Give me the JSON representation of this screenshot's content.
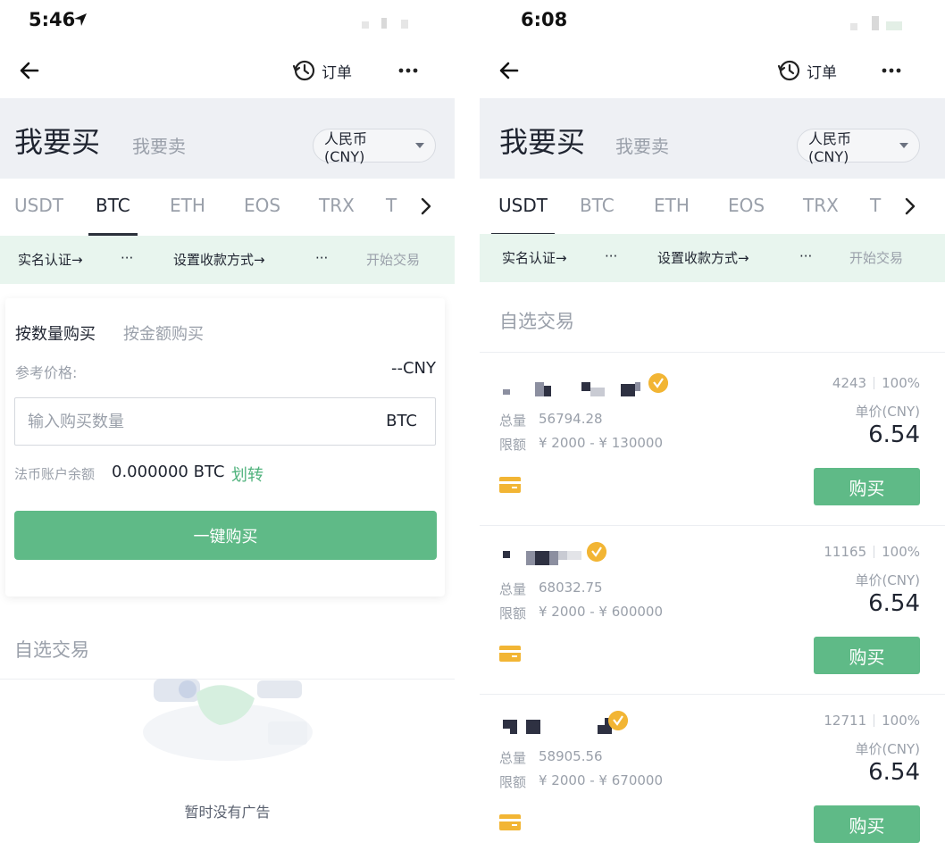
{
  "left": {
    "status": {
      "time": "5:46"
    },
    "nav": {
      "orders_label": "订单"
    },
    "tabs": {
      "buy": "我要买",
      "sell": "我要卖",
      "currency": "人民币(CNY)"
    },
    "coins": [
      "USDT",
      "BTC",
      "ETH",
      "EOS",
      "TRX",
      "T"
    ],
    "active_coin": "BTC",
    "steps": {
      "verify": "实名认证→",
      "dots1": "···",
      "payment": "设置收款方式→",
      "dots2": "···",
      "start": "开始交易"
    },
    "card": {
      "tab_qty": "按数量购买",
      "tab_amount": "按金额购买",
      "ref_label": "参考价格:",
      "ref_value": "--CNY",
      "input_placeholder": "输入购买数量",
      "input_unit": "BTC",
      "balance_label": "法币账户余额",
      "balance_value": "0.000000 BTC",
      "transfer": "划转",
      "one_click": "一键购买"
    },
    "fav_title": "自选交易",
    "empty_text": "暂时没有广告"
  },
  "right": {
    "status": {
      "time": "6:08"
    },
    "nav": {
      "orders_label": "订单"
    },
    "tabs": {
      "buy": "我要买",
      "sell": "我要卖",
      "currency": "人民币(CNY)"
    },
    "coins": [
      "USDT",
      "BTC",
      "ETH",
      "EOS",
      "TRX",
      "T"
    ],
    "active_coin": "USDT",
    "steps": {
      "verify": "实名认证→",
      "dots1": "···",
      "payment": "设置收款方式→",
      "dots2": "···",
      "start": "开始交易"
    },
    "fav_title": "自选交易",
    "ads": [
      {
        "qty_label": "总量",
        "qty": "56794.28",
        "limit_label": "限额",
        "limit": "¥ 2000 - ¥ 130000",
        "orders": "4243",
        "rate": "100%",
        "unit_label": "单价(CNY)",
        "price": "6.54",
        "buy": "购买"
      },
      {
        "qty_label": "总量",
        "qty": "68032.75",
        "limit_label": "限额",
        "limit": "¥ 2000 - ¥ 600000",
        "orders": "11165",
        "rate": "100%",
        "unit_label": "单价(CNY)",
        "price": "6.54",
        "buy": "购买"
      },
      {
        "qty_label": "总量",
        "qty": "58905.56",
        "limit_label": "限额",
        "limit": "¥ 2000 - ¥ 670000",
        "orders": "12711",
        "rate": "100%",
        "unit_label": "单价(CNY)",
        "price": "6.54",
        "buy": "购买"
      }
    ]
  },
  "colors": {
    "accent_green": "#5fba87",
    "header_gray": "#eef0f4",
    "steps_bg": "#e8f5ee",
    "verify_badge": "#f2b534"
  },
  "icons": [
    "location-arrow-icon",
    "back-arrow-icon",
    "history-clock-icon",
    "more-dots-icon",
    "chevron-down-icon",
    "chevron-right-icon",
    "verified-badge-icon",
    "bank-card-icon"
  ]
}
